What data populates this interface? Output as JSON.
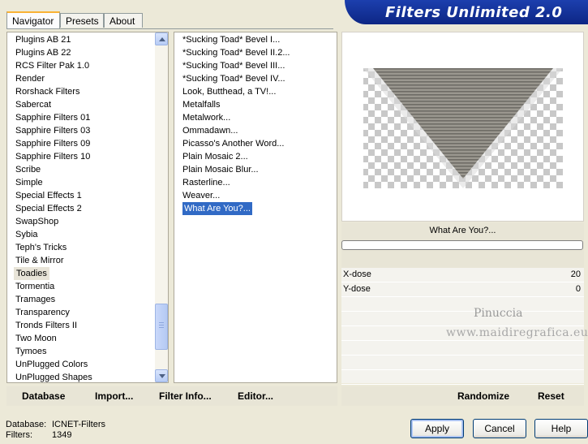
{
  "tabs": [
    "Navigator",
    "Presets",
    "About"
  ],
  "banner": "Filters Unlimited 2.0",
  "categories": [
    "Plugins AB 21",
    "Plugins AB 22",
    "RCS Filter Pak 1.0",
    "Render",
    "Rorshack Filters",
    "Sabercat",
    "Sapphire Filters 01",
    "Sapphire Filters 03",
    "Sapphire Filters 09",
    "Sapphire Filters 10",
    "Scribe",
    "Simple",
    "Special Effects 1",
    "Special Effects 2",
    "SwapShop",
    "Sybia",
    "Teph's Tricks",
    "Tile & Mirror",
    "Toadies",
    "Tormentia",
    "Tramages",
    "Transparency",
    "Tronds Filters II",
    "Two Moon",
    "Tymoes",
    "UnPlugged Colors",
    "UnPlugged Shapes"
  ],
  "selected_category": "Toadies",
  "filters": [
    "*Sucking Toad*  Bevel I...",
    "*Sucking Toad*  Bevel II.2...",
    "*Sucking Toad*  Bevel III...",
    "*Sucking Toad*  Bevel IV...",
    "Look, Butthead, a TV!...",
    "Metalfalls",
    "Metalwork...",
    "Ommadawn...",
    "Picasso's Another Word...",
    "Plain Mosaic 2...",
    "Plain Mosaic Blur...",
    "Rasterline...",
    "Weaver...",
    "What Are You?..."
  ],
  "selected_filter": "What Are You?...",
  "filter_name": "What Are You?...",
  "progress": 0,
  "params": [
    {
      "label": "X-dose",
      "value": "20"
    },
    {
      "label": "Y-dose",
      "value": "0"
    }
  ],
  "watermark": {
    "line1": "Pinuccia",
    "line2": "www.maidiregrafica.eu"
  },
  "toolbar": {
    "database": "Database",
    "import": "Import...",
    "filter_info": "Filter Info...",
    "editor": "Editor...",
    "randomize": "Randomize",
    "reset": "Reset"
  },
  "status": {
    "db_label": "Database:",
    "db_value": "ICNET-Filters",
    "filters_label": "Filters:",
    "filters_value": "1349"
  },
  "buttons": {
    "apply": "Apply",
    "cancel": "Cancel",
    "help": "Help"
  },
  "colors": {
    "banner": "#1C3FAE",
    "selection": "#316AC5",
    "window": "#ECE9D8"
  }
}
